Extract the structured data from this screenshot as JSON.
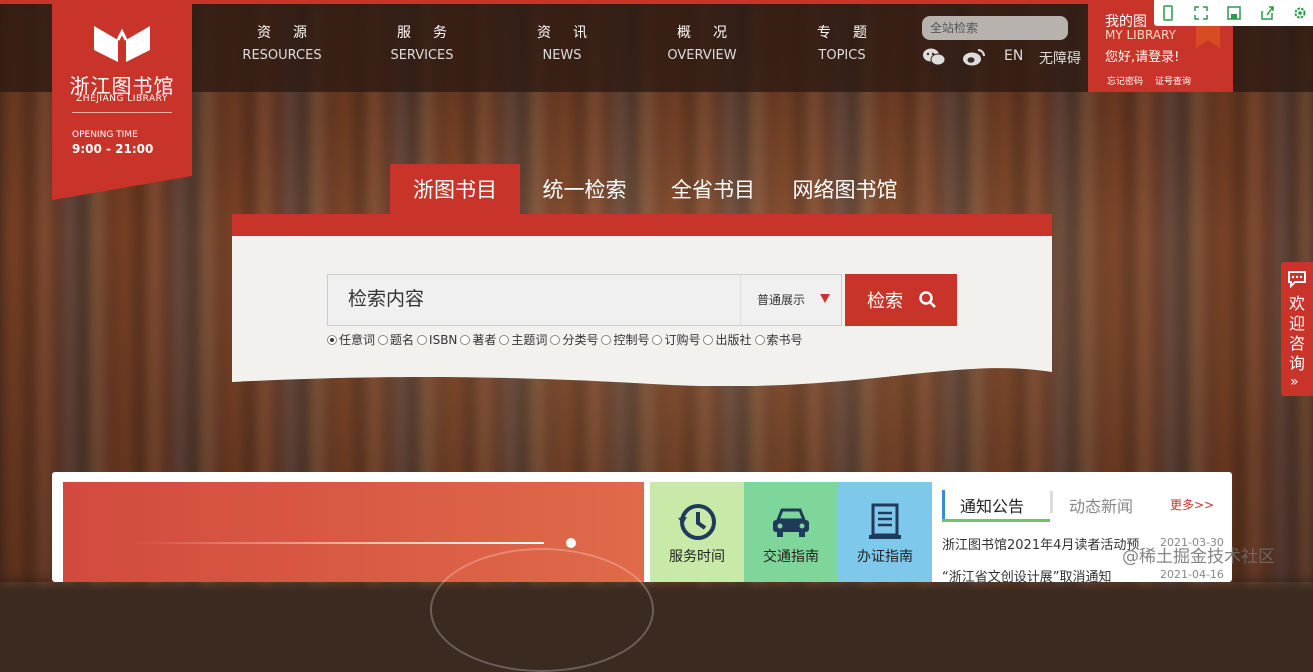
{
  "logo": {
    "name_cn": "浙江图书馆",
    "name_en": "ZHEJIANG LIBRARY",
    "opening_label": "OPENING TIME",
    "opening_time": "9:00 - 21:00"
  },
  "nav": [
    {
      "cn": "资源",
      "en": "RESOURCES"
    },
    {
      "cn": "服务",
      "en": "SERVICES"
    },
    {
      "cn": "资讯",
      "en": "NEWS"
    },
    {
      "cn": "概况",
      "en": "OVERVIEW"
    },
    {
      "cn": "专题",
      "en": "TOPICS"
    }
  ],
  "header": {
    "site_search_placeholder": "全站检索",
    "lang": "EN",
    "accessibility": "无障碍"
  },
  "mylib": {
    "title_cn": "我的图",
    "title_en": "MY LIBRARY",
    "greeting": "您好,请登录!",
    "forgot_password": "忘记密码",
    "card_query": "证号查询"
  },
  "search_tabs": [
    "浙图书目",
    "统一检索",
    "全省书目",
    "网络图书馆"
  ],
  "search": {
    "placeholder": "检索内容",
    "mode": "普通展示",
    "button": "检索",
    "options": [
      "任意词",
      "题名",
      "ISBN",
      "著者",
      "主题词",
      "分类号",
      "控制号",
      "订购号",
      "出版社",
      "索书号"
    ],
    "checked_index": 0
  },
  "tiles": [
    {
      "label": "服务时间",
      "color": "#c9e9a8"
    },
    {
      "label": "交通指南",
      "color": "#7fd69a"
    },
    {
      "label": "办证指南",
      "color": "#7ec8ec"
    }
  ],
  "news": {
    "tab_active": "通知公告",
    "tab_other": "动态新闻",
    "more": "更多>>",
    "items": [
      {
        "title": "浙江图书馆2021年4月读者活动预",
        "date": "2021-03-30"
      },
      {
        "title": "“浙江省文创设计展”取消通知",
        "date": "2021-04-16"
      }
    ]
  },
  "consult": {
    "label": "欢迎咨询",
    "arrow": "»"
  },
  "watermark": "@稀土掘金技术社区",
  "colors": {
    "brand_red": "#c8342a"
  }
}
